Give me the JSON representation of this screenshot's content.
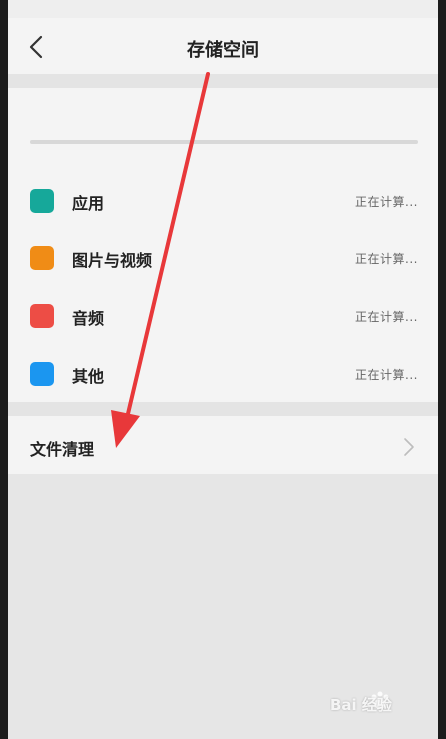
{
  "header": {
    "title": "存储空间",
    "back_icon": "chevron-left-icon"
  },
  "storage": {
    "items": [
      {
        "label": "应用",
        "status": "正在计算...",
        "color": "#16a89a"
      },
      {
        "label": "图片与视频",
        "status": "正在计算...",
        "color": "#f08c16"
      },
      {
        "label": "音频",
        "status": "正在计算...",
        "color": "#ed4d45"
      },
      {
        "label": "其他",
        "status": "正在计算...",
        "color": "#1b96f0"
      }
    ]
  },
  "cleanup": {
    "label": "文件清理",
    "icon": "chevron-right-icon"
  },
  "overlay": {
    "arrow_color": "#e8383a"
  },
  "watermark": {
    "text": "Bai 经验"
  }
}
